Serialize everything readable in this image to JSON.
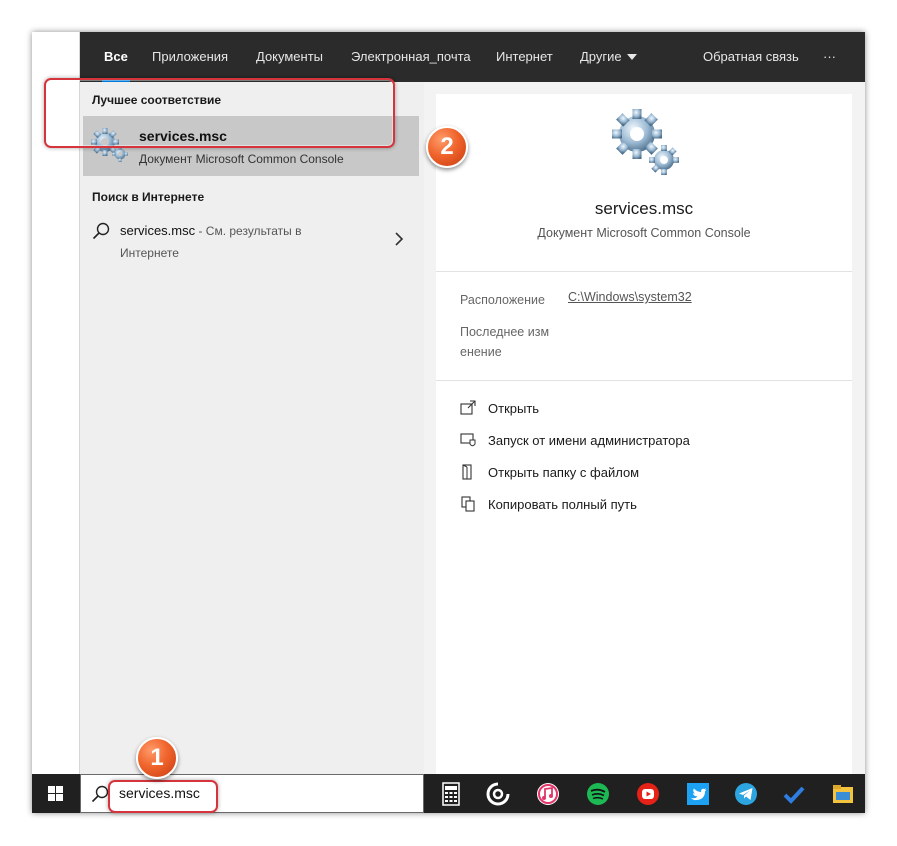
{
  "tabs": [
    {
      "label": "Все",
      "active": true
    },
    {
      "label": "Приложения"
    },
    {
      "label": "Документы"
    },
    {
      "label": "Электронная_почта"
    },
    {
      "label": "Интернет"
    },
    {
      "label": "Другие"
    },
    {
      "label": "Обратная связь"
    },
    {
      "label": "···"
    }
  ],
  "results": {
    "best_match_title": "Лучшее соответствие",
    "best_match": {
      "name": "services.msc",
      "subtitle": "Документ Microsoft Common Console",
      "icon": "gear-icon"
    },
    "web_title": "Поиск в Интернете",
    "web_item": {
      "query": "services.msc",
      "suffix": " - См. результаты в Интернете"
    }
  },
  "preview": {
    "title": "services.msc",
    "subtitle": "Документ Microsoft Common Console",
    "location_label": "Расположение",
    "location_value": "C:\\Windows\\system32",
    "modified_label_1": "Последнее изм",
    "modified_label_2": "енение",
    "actions": [
      {
        "label": "Открыть",
        "icon": "open-icon"
      },
      {
        "label": "Запуск от имени администратора",
        "icon": "admin-shield-icon"
      },
      {
        "label": "Открыть папку с файлом",
        "icon": "folder-open-icon"
      },
      {
        "label": "Копировать полный путь",
        "icon": "copy-icon"
      }
    ]
  },
  "taskbar": {
    "search_value": "services.msc",
    "apps": [
      "calculator-icon",
      "cortana-ring-icon",
      "itunes-icon",
      "spotify-icon",
      "youtube-icon",
      "twitter-icon",
      "telegram-icon",
      "todo-check-icon",
      "file-explorer-icon"
    ]
  },
  "annotations": {
    "badge_1": "1",
    "badge_2": "2"
  },
  "colors": {
    "accent": "#0078d7",
    "highlight_border": "#d6343c",
    "badge": "#f0642c",
    "tabbar_bg": "#2b2b2b",
    "taskbar_bg": "#202020"
  }
}
